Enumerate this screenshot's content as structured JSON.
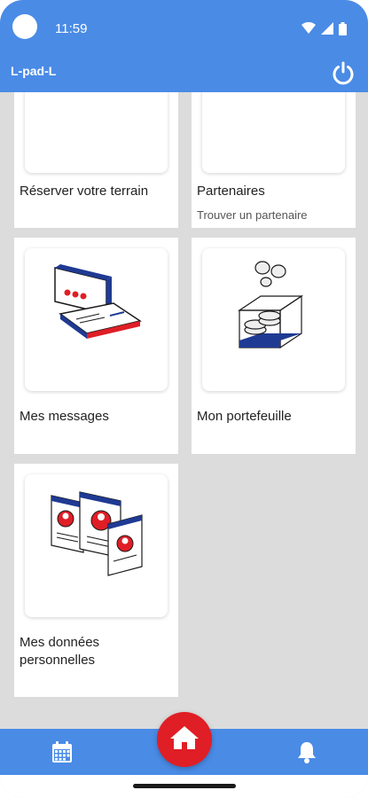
{
  "status_bar": {
    "time": "11:59"
  },
  "app_bar": {
    "title": "L-pad-L",
    "power_icon": "power-icon"
  },
  "cards": [
    {
      "title": "Réserver votre terrain",
      "subtitle": ""
    },
    {
      "title": "Partenaires",
      "subtitle": "Trouver un partenaire"
    },
    {
      "title": "Mes messages",
      "subtitle": ""
    },
    {
      "title": "Mon portefeuille",
      "subtitle": ""
    },
    {
      "title": "Mes données personnelles",
      "subtitle": ""
    }
  ],
  "bottom_nav": {
    "items": [
      "calendar-icon",
      "home-icon",
      "bell-icon"
    ],
    "active": "home-icon"
  },
  "colors": {
    "primary": "#4a8be6",
    "accent": "#e01e26",
    "background": "#dcdcdc",
    "illustration_blue": "#1f3a93"
  }
}
